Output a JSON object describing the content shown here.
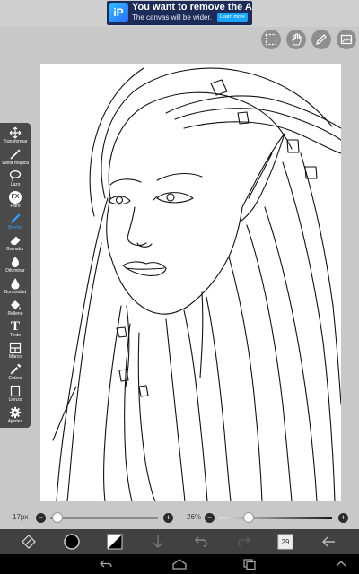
{
  "ad": {
    "logo_text": "iP",
    "title": "You want to remove the Ad?",
    "subtitle": "The canvas will be wider.",
    "button": "Learn more"
  },
  "header": {
    "icons": [
      "selection-icon",
      "hand-icon",
      "pen-icon",
      "image-icon"
    ]
  },
  "tools": [
    {
      "label": "Transformar",
      "icon": "move-icon"
    },
    {
      "label": "Varita mágica",
      "icon": "magic-wand-icon"
    },
    {
      "label": "Lazo",
      "icon": "lasso-icon"
    },
    {
      "label": "Filtro",
      "icon": "fx-icon",
      "glyph": "FX"
    },
    {
      "label": "Brocha",
      "icon": "brush-icon",
      "active": true
    },
    {
      "label": "Borrador",
      "icon": "eraser-icon"
    },
    {
      "label": "Difuminar",
      "icon": "smudge-icon"
    },
    {
      "label": "Borrosidad",
      "icon": "blur-icon"
    },
    {
      "label": "Relleno",
      "icon": "fill-icon"
    },
    {
      "label": "Texto",
      "icon": "text-icon",
      "glyph": "T"
    },
    {
      "label": "Marco",
      "icon": "frame-icon"
    },
    {
      "label": "Gotero",
      "icon": "eyedropper-icon"
    },
    {
      "label": "Lienzo",
      "icon": "canvas-icon"
    },
    {
      "label": "Ajustes",
      "icon": "gear-icon"
    }
  ],
  "sliders": {
    "brush_size_label": "17px",
    "brush_size_value_fraction": 0.03,
    "opacity_label": "26%",
    "opacity_value_fraction": 0.26,
    "minus": "−",
    "plus": "+"
  },
  "actions": {
    "icons": [
      "brush-settings-icon",
      "color-picker-icon",
      "secondary-color-icon",
      "download-icon",
      "undo-icon",
      "redo-icon",
      "layers-icon",
      "back-icon"
    ],
    "layer_count": "29",
    "colors": {
      "primary": "#000000",
      "secondary_a": "#ffffff",
      "secondary_b": "#000000"
    }
  },
  "navbar": {
    "icons": [
      "nav-back-icon",
      "nav-home-icon",
      "nav-recents-icon",
      "nav-up-icon"
    ]
  },
  "colors": {
    "accent": "#36a2ff",
    "panel": "#4a4a4a",
    "action_bar": "#414141",
    "background": "#c8c8c8"
  }
}
